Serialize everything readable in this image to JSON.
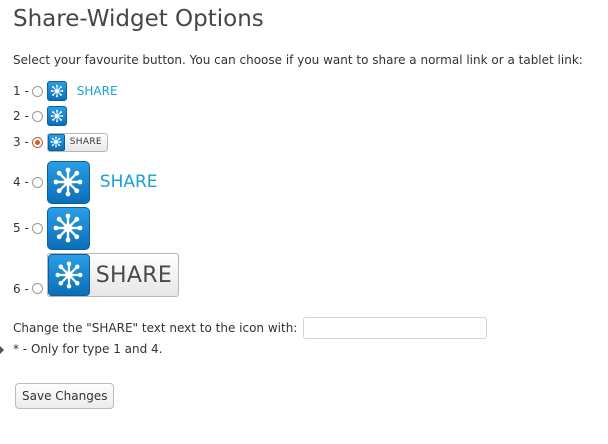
{
  "page": {
    "title": "Share-Widget Options"
  },
  "intro": "Select your favourite button. You can choose if you want to share a normal link or a tablet link:",
  "options": [
    {
      "num": "1 -",
      "share_label": "SHARE",
      "selected": false
    },
    {
      "num": "2 -",
      "selected": false
    },
    {
      "num": "3 -",
      "share_label": "SHARE",
      "selected": true
    },
    {
      "num": "4 -",
      "share_label": "SHARE",
      "selected": false
    },
    {
      "num": "5 -",
      "selected": false
    },
    {
      "num": "6 -",
      "share_label": "SHARE",
      "selected": false
    }
  ],
  "share_text_field": {
    "label": "Change the \"SHARE\" text next to the icon with:",
    "value": "",
    "placeholder": ""
  },
  "note": "* - Only for type 1 and 4.",
  "save_button": {
    "label": "Save Changes"
  },
  "colors": {
    "icon_blue": "#1186d4",
    "share_text": "#1b9fd6",
    "radio_selected": "#e05a2a"
  },
  "icons": {
    "share": "share-star-icon"
  }
}
